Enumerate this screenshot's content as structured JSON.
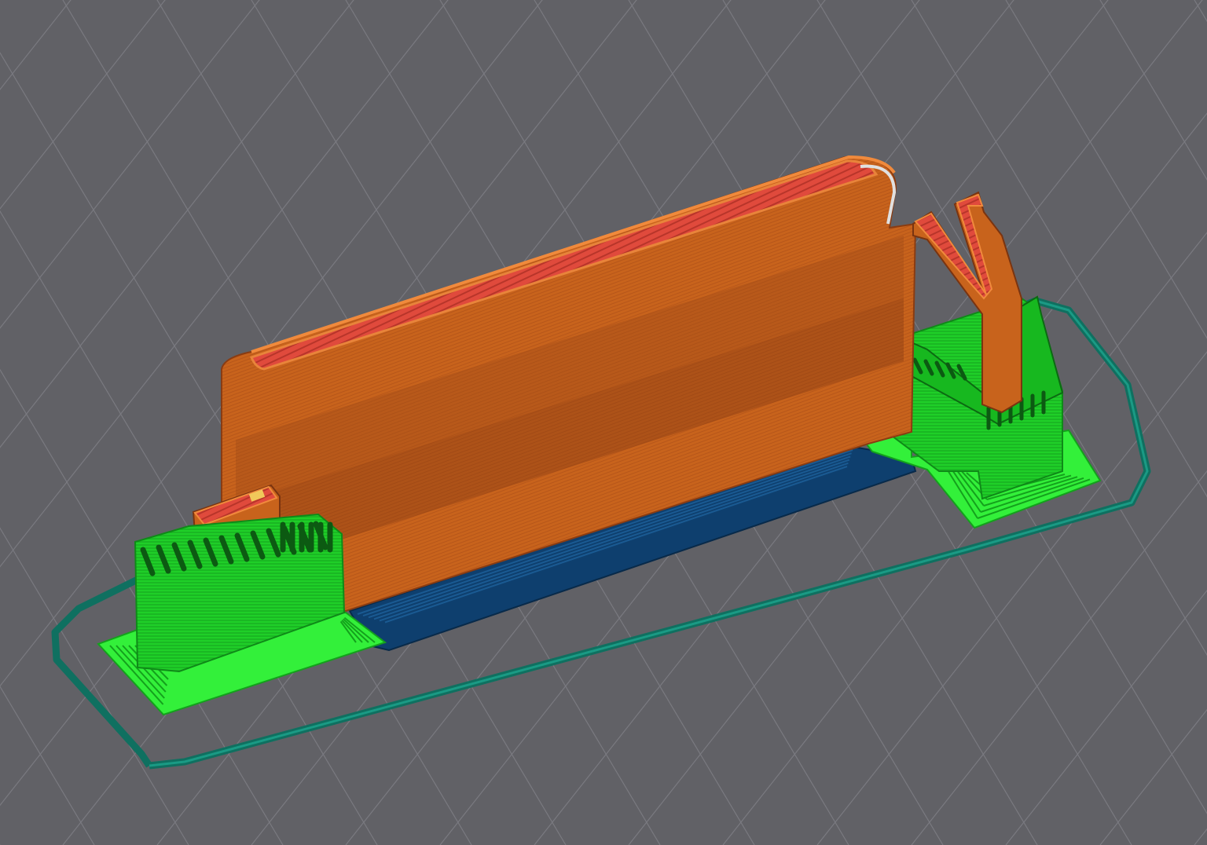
{
  "viewport": {
    "kind": "3d-slicer-gcode-preview",
    "background_color": "#616166",
    "bed_grid_color": "#7a7a80"
  },
  "gcode_preview": {
    "feature_colors": {
      "perimeter": "#d2691e",
      "perimeter_dark": "#7a3410",
      "external_perimeter_light": "#e8843a",
      "solid_infill": "#e04a3c",
      "top_infill": "#f0c85a",
      "support_material": "#1fdc2a",
      "support_dark": "#0f8a18",
      "support_interface": "#0c5a12",
      "skirt": "#127a6a",
      "first_layer_infill": "#0e3f6e",
      "gap_fill": "#e8e8e8"
    },
    "objects": [
      {
        "name": "backrest-wall",
        "feature": "perimeter"
      },
      {
        "name": "hook-tab",
        "feature": "perimeter"
      },
      {
        "name": "left-support-tower",
        "feature": "support_material"
      },
      {
        "name": "right-support-tower",
        "feature": "support_material"
      },
      {
        "name": "base-infill-strip",
        "feature": "first_layer_infill"
      },
      {
        "name": "skirt-loop",
        "feature": "skirt"
      }
    ]
  }
}
